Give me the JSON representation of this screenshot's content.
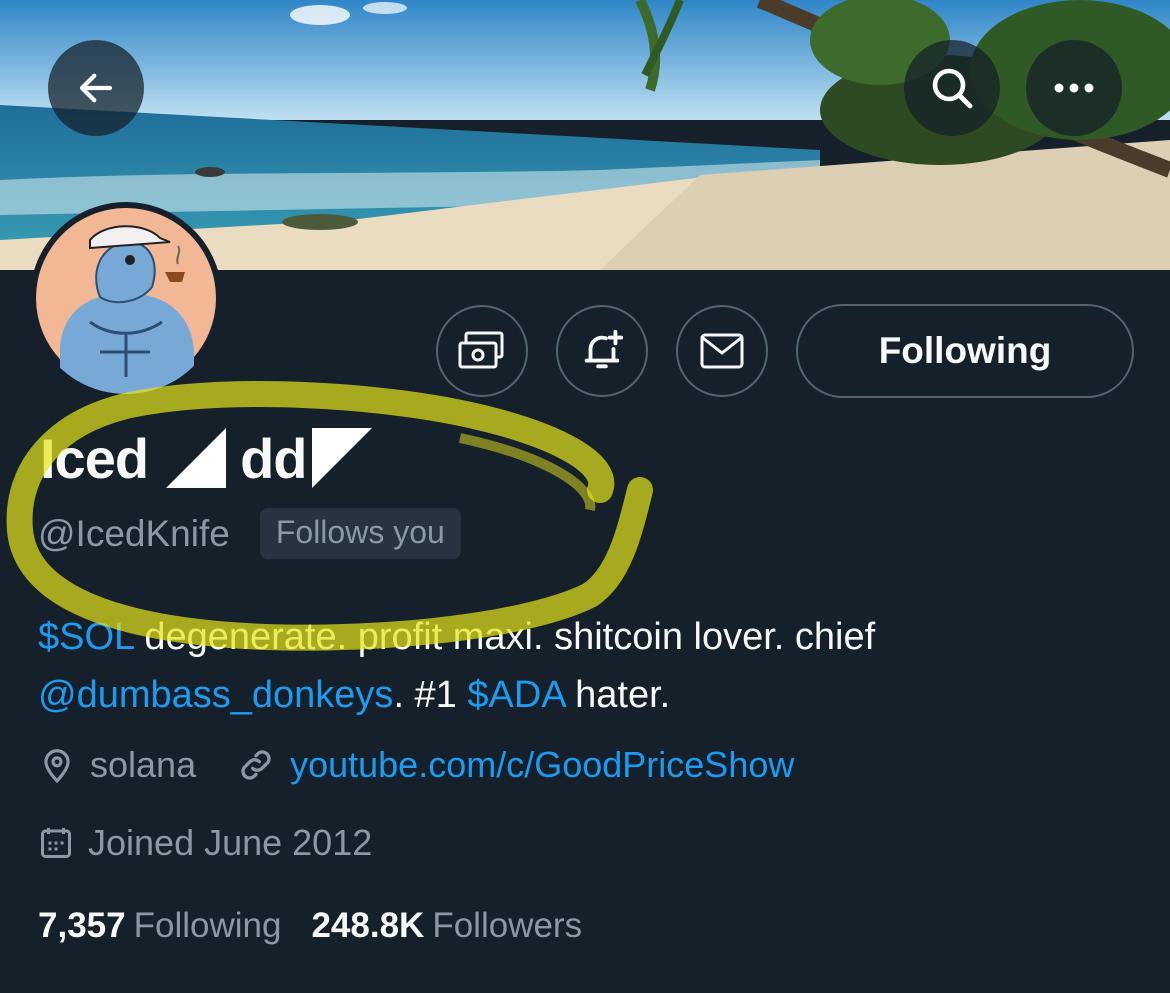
{
  "profile": {
    "name_part1": "Iced",
    "name_part2": "dd",
    "handle": "@IcedKnife",
    "follows_you": "Follows you",
    "bio": {
      "sol": "$SOL",
      "text1": " degenerate. profit maxi. shitcoin lover. chief",
      "mention": "@dumbass_donkeys",
      "text2": ". #1 ",
      "ada": "$ADA",
      "text3": " hater."
    },
    "location": "solana",
    "website": "youtube.com/c/GoodPriceShow",
    "joined": "Joined June 2012",
    "following_count": "7,357",
    "following_label": "Following",
    "followers_count": "248.8K",
    "followers_label": "Followers"
  },
  "actions": {
    "follow_button": "Following"
  },
  "icons": {
    "back": "arrow-left-icon",
    "search": "search-icon",
    "more": "more-icon",
    "tip": "money-icon",
    "notify": "bell-plus-icon",
    "message": "envelope-icon",
    "location": "location-pin-icon",
    "website": "link-icon",
    "joined": "calendar-icon"
  },
  "colors": {
    "background": "#15202b",
    "link": "#1d9bf0",
    "muted": "#8b98a5",
    "highlight": "#e5e51a"
  }
}
